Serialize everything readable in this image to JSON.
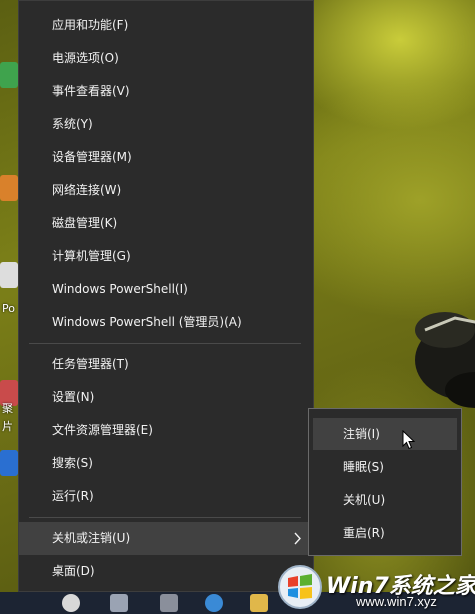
{
  "menu": {
    "items": [
      {
        "label": "应用和功能(F)"
      },
      {
        "label": "电源选项(O)"
      },
      {
        "label": "事件查看器(V)"
      },
      {
        "label": "系统(Y)"
      },
      {
        "label": "设备管理器(M)"
      },
      {
        "label": "网络连接(W)"
      },
      {
        "label": "磁盘管理(K)"
      },
      {
        "label": "计算机管理(G)"
      },
      {
        "label": "Windows PowerShell(I)"
      },
      {
        "label": "Windows PowerShell (管理员)(A)"
      },
      {
        "label": "任务管理器(T)"
      },
      {
        "label": "设置(N)"
      },
      {
        "label": "文件资源管理器(E)"
      },
      {
        "label": "搜索(S)"
      },
      {
        "label": "运行(R)"
      },
      {
        "label": "关机或注销(U)"
      },
      {
        "label": "桌面(D)"
      }
    ]
  },
  "submenu": {
    "items": [
      {
        "label": "注销(I)"
      },
      {
        "label": "睡眠(S)"
      },
      {
        "label": "关机(U)"
      },
      {
        "label": "重启(R)"
      }
    ]
  },
  "desktop": {
    "icon_labels": [
      "Po",
      "聚",
      "片"
    ]
  },
  "watermark": {
    "brand": "Win7系统之家",
    "url": "www.win7.xyz"
  },
  "colors": {
    "menu_bg": "#2b2b2b",
    "hover_bg": "#414141",
    "text": "#f2f2f2"
  }
}
